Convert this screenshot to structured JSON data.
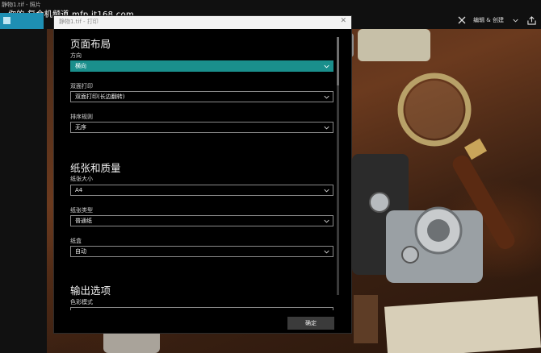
{
  "window": {
    "titlebar_text": "静物1.tif - 照片",
    "watermark": "你的·复合机频道 mfp.it168.com"
  },
  "app": {
    "right_toolbar": {
      "edit_create_label": "编辑 & 创建"
    }
  },
  "dialog": {
    "title": "静物1.tif - 打印",
    "sections": {
      "page_layout": "页面布局",
      "paper_quality": "纸张和质量",
      "output_options": "输出选项"
    },
    "fields": {
      "orientation": {
        "label": "方向",
        "value": "横向"
      },
      "duplex": {
        "label": "双面打印",
        "value": "双面打印(长边翻转)"
      },
      "collation": {
        "label": "排序规则",
        "value": "无序"
      },
      "paper_size": {
        "label": "纸张大小",
        "value": "A4"
      },
      "paper_type": {
        "label": "纸张类型",
        "value": "普通纸"
      },
      "paper_tray": {
        "label": "纸盒",
        "value": "自动"
      },
      "color_mode": {
        "label": "色彩模式"
      }
    },
    "ok_label": "确定"
  },
  "colors": {
    "accent": "#1a8f8c",
    "dialog_bg": "#000000",
    "app_tile": "#1e8fb3"
  }
}
